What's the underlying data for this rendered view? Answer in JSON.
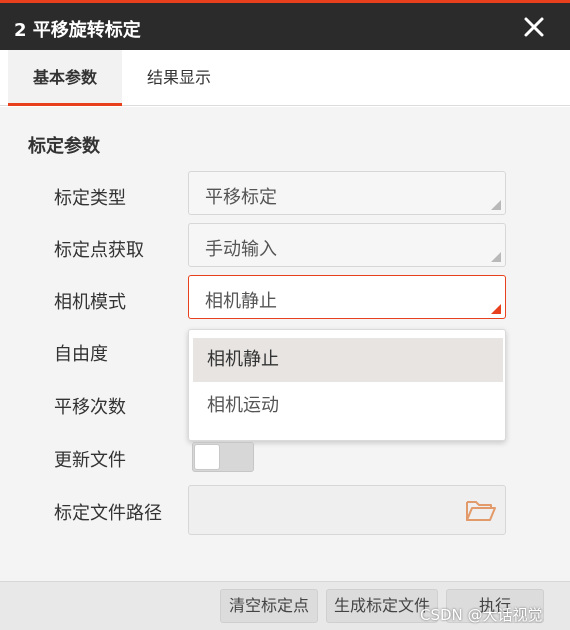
{
  "window": {
    "title": "2 平移旋转标定",
    "close_icon": "close-icon"
  },
  "tabs": [
    {
      "label": "基本参数",
      "active": true
    },
    {
      "label": "结果显示",
      "active": false
    }
  ],
  "section_title": "标定参数",
  "fields": {
    "calib_type": {
      "label": "标定类型",
      "value": "平移标定"
    },
    "point_acquire": {
      "label": "标定点获取",
      "value": "手动输入"
    },
    "camera_mode": {
      "label": "相机模式",
      "value": "相机静止"
    },
    "dof": {
      "label": "自由度"
    },
    "shift_count": {
      "label": "平移次数"
    },
    "update_file": {
      "label": "更新文件",
      "on": false
    },
    "file_path": {
      "label": "标定文件路径",
      "value": "",
      "icon": "folder-open-icon"
    }
  },
  "dropdown": {
    "options": [
      "相机静止",
      "相机运动"
    ],
    "selected": "相机静止"
  },
  "footer": {
    "clear_points": "清空标定点",
    "generate_file": "生成标定文件",
    "execute": "执行",
    "watermark": "CSDN @大话视觉"
  },
  "colors": {
    "accent": "#e8401c",
    "titlebar": "#2b2b2b"
  }
}
